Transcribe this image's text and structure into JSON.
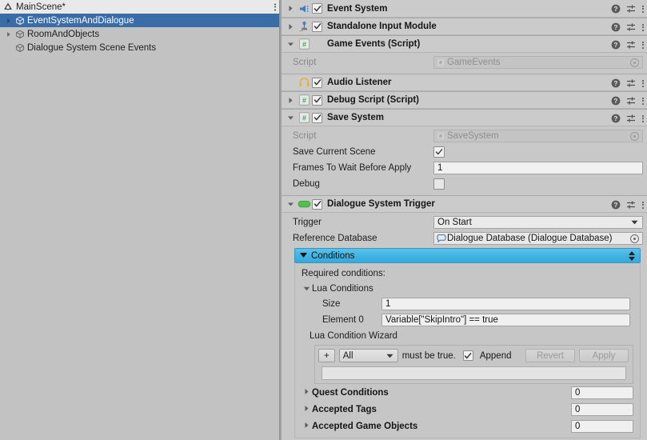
{
  "hierarchy": {
    "scene_name": "MainScene*",
    "scene_icon": "unity-scene-icon",
    "menu_icon": "kebab-menu-icon",
    "items": [
      {
        "label": "EventSystemAndDialogue",
        "icon": "gameobject-cube-icon",
        "expandable": true,
        "selected": true,
        "indent": 0
      },
      {
        "label": "RoomAndObjects",
        "icon": "gameobject-cube-icon",
        "expandable": true,
        "selected": false,
        "indent": 0
      },
      {
        "label": "Dialogue System Scene Events",
        "icon": "gameobject-cube-icon",
        "expandable": false,
        "selected": false,
        "indent": 0
      }
    ]
  },
  "inspector": {
    "header_icons": {
      "help": "help-icon",
      "preset": "preset-sliders-icon",
      "menu": "kebab-menu-icon"
    },
    "components": [
      {
        "title": "Event System",
        "icon": "event-system-icon",
        "expanded": false,
        "has_checkbox": true,
        "checked": true
      },
      {
        "title": "Standalone Input Module",
        "icon": "input-module-joystick-icon",
        "expanded": false,
        "has_checkbox": true,
        "checked": true
      },
      {
        "title": "Game Events (Script)",
        "icon": "csharp-script-icon",
        "expanded": true,
        "has_checkbox": false,
        "checked": false
      },
      {
        "title": "Audio Listener",
        "icon": "audio-listener-headphones-icon",
        "expanded": false,
        "has_checkbox": true,
        "checked": true,
        "no_foldout": true
      },
      {
        "title": "Debug Script (Script)",
        "icon": "csharp-script-icon",
        "expanded": false,
        "has_checkbox": true,
        "checked": true
      },
      {
        "title": "Save System",
        "icon": "csharp-script-icon",
        "expanded": true,
        "has_checkbox": true,
        "checked": true
      },
      {
        "title": "Dialogue System Trigger",
        "icon": "dialogue-trigger-pill-icon",
        "expanded": true,
        "has_checkbox": true,
        "checked": true
      }
    ],
    "game_events": {
      "script_label": "Script",
      "script_value": "GameEvents"
    },
    "save_system": {
      "script_label": "Script",
      "script_value": "SaveSystem",
      "save_current_scene_label": "Save Current Scene",
      "save_current_scene_checked": true,
      "frames_label": "Frames To Wait Before Apply",
      "frames_value": "1",
      "debug_label": "Debug",
      "debug_checked": false
    },
    "dialogue_trigger": {
      "trigger_label": "Trigger",
      "trigger_value": "On Start",
      "reference_db_label": "Reference Database",
      "reference_db_value": "Dialogue Database (Dialogue Database)",
      "conditions_header": "Conditions",
      "conditions_header_color": "#3eb3e3",
      "required_conditions_label": "Required conditions:",
      "lua_conditions_label": "Lua Conditions",
      "size_label": "Size",
      "size_value": "1",
      "element0_label": "Element 0",
      "element0_value": "Variable[\"SkipIntro\"] == true",
      "wizard_label": "Lua Condition Wizard",
      "wizard_add_button": "+",
      "wizard_all_value": "All",
      "wizard_must_be_true": "must be true.",
      "wizard_append_label": "Append",
      "wizard_append_checked": true,
      "wizard_revert_button": "Revert",
      "wizard_apply_button": "Apply",
      "wizard_preview_value": "",
      "foldouts": [
        {
          "label": "Quest Conditions",
          "count": "0"
        },
        {
          "label": "Accepted Tags",
          "count": "0"
        },
        {
          "label": "Accepted Game Objects",
          "count": "0"
        }
      ]
    }
  }
}
